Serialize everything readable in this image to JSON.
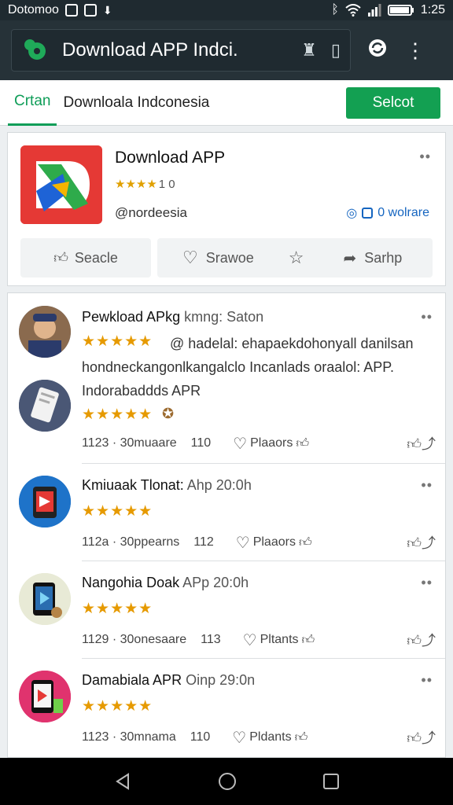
{
  "status_bar": {
    "carrier": "Dotomoo",
    "time": "1:25"
  },
  "browser": {
    "url_text": "Download APP Indci."
  },
  "tab_bar": {
    "active_tab": "Crtan",
    "page_title": "Downloala Indconesia",
    "select_label": "Selcot"
  },
  "app_card": {
    "title": "Download APP",
    "rating_stars": "★★★★",
    "rating_value": "1 0",
    "developer": "@nordeesia",
    "link_label": "0 wolrare",
    "actions": [
      {
        "label": "Seacle"
      },
      {
        "label": "Srawoe"
      },
      {
        "label": "Sarhp"
      }
    ]
  },
  "reviews": [
    {
      "name": "Pewkload APkg",
      "meta": " kmng: Saton",
      "body": "@ hadelal: ehapaekdohonyall danilsan hondneckangonlkangalclo Incanlads oraalol: APP. Indorabaddds APR",
      "stars": "★★★★★",
      "stats": "1123 · 30muaare",
      "count": "110",
      "helpful": "Plaaors"
    },
    {
      "name": "Kmiuaak Tlonat:",
      "meta": " Ahp 20:0h",
      "stars": "★★★★★",
      "stats": "112a · 30ppearns",
      "count": "112",
      "helpful": "Plaaors"
    },
    {
      "name": "Nangohia Doak",
      "meta": " APp 20:0h",
      "stars": "★★★★★",
      "stats": "1129 · 30onesaare",
      "count": "113",
      "helpful": "Pltants"
    },
    {
      "name": "Damabiala APR",
      "meta": " Oinp 29:0n",
      "stars": "★★★★★",
      "stats": "1123 · 30mnama",
      "count": "110",
      "helpful": "Pldants"
    }
  ]
}
